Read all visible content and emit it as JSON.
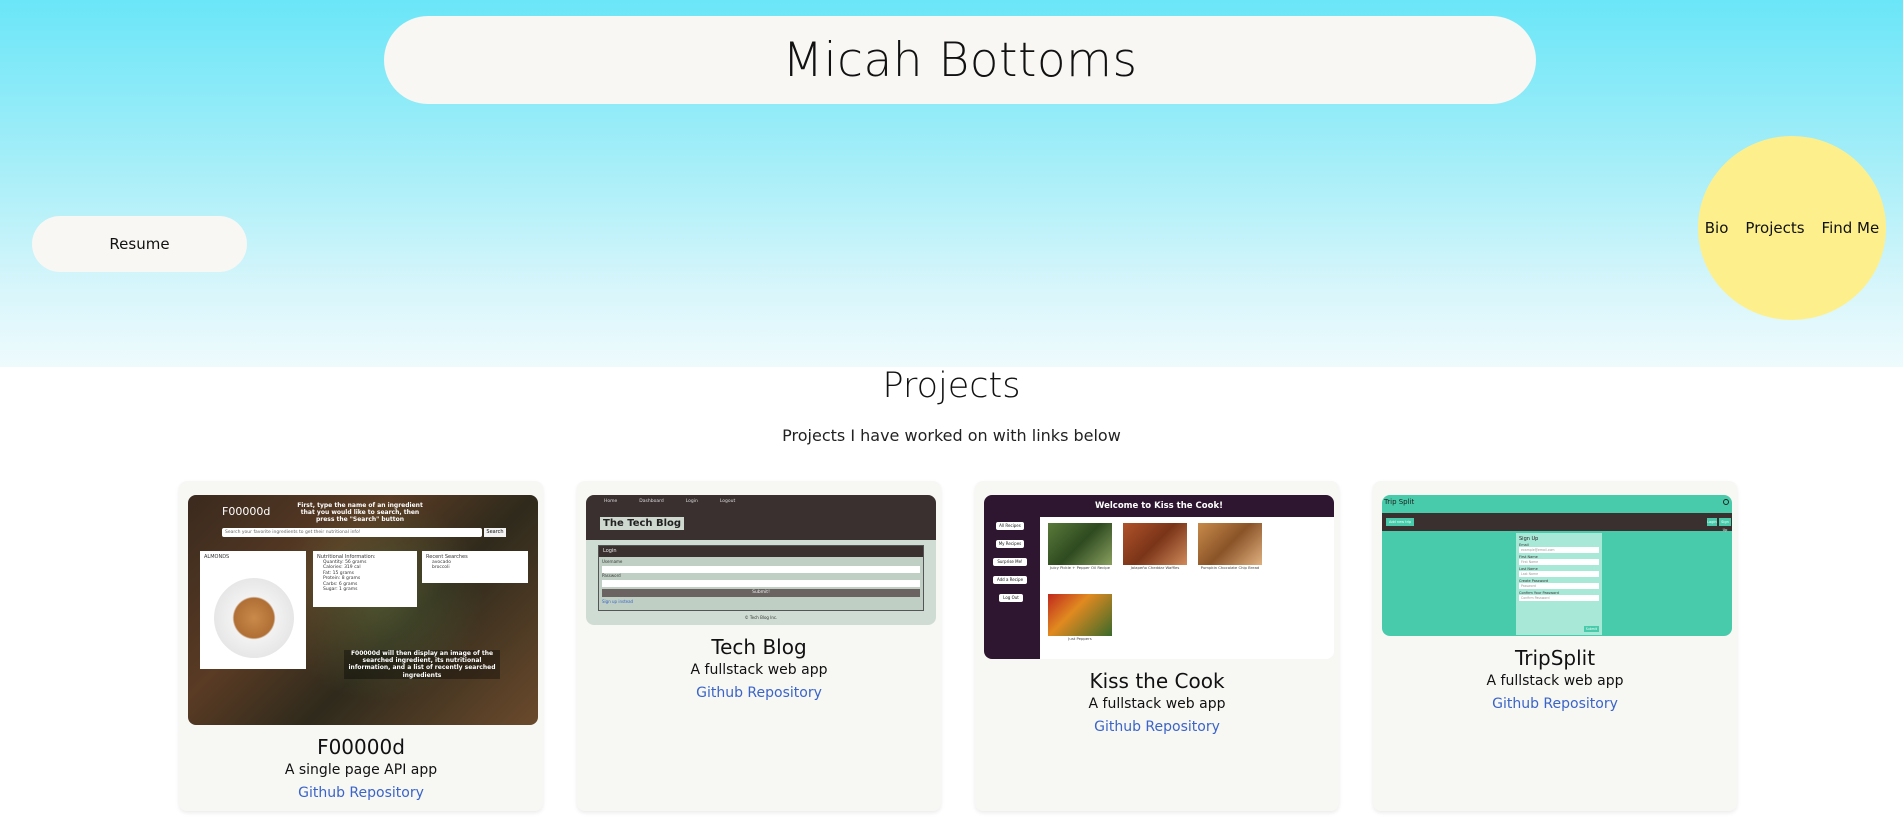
{
  "header": {
    "title": "Micah Bottoms",
    "resume_label": "Resume"
  },
  "nav": {
    "items": [
      "Bio",
      "Projects",
      "Find Me"
    ]
  },
  "projects_section": {
    "title": "Projects",
    "subtitle": "Projects I have worked on with links below",
    "cards": [
      {
        "title": "F00000d",
        "description": "A single page API app",
        "link": "Github Repository",
        "shot": {
          "brand": "F00000d",
          "instruction": "First, type the name of an ingredient that you would like to search, then press the \"Search\" button",
          "search_placeholder": "Search your favorite ingredients to get their nutritional info!",
          "search_btn": "Search",
          "ingredient": "ALMONDS",
          "nutrition_title": "Nutritional Information:",
          "nutrition_items": [
            "Quantity: 56 grams",
            "Calories: 319 cal",
            "Fat: 15 grams",
            "Protein: 8 grams",
            "Carbs: 6 grams",
            "Sugar: 1 grams"
          ],
          "recent_title": "Recent Searches",
          "recent_items": [
            "avocado",
            "broccoli"
          ],
          "caption": "F00000d will then display an image of the searched ingredient, its nutritional information, and a list of recently searched ingredients"
        }
      },
      {
        "title": "Tech Blog",
        "description": "A fullstack web app",
        "link": "Github Repository",
        "shot": {
          "nav": [
            "Home",
            "Dashboard",
            "Login",
            "Logout"
          ],
          "brand": "The Tech Blog",
          "form_title": "Login",
          "field1": "Username",
          "field2": "Password",
          "submit": "Submit!",
          "signup": "Sign up instead",
          "footer": "© Tech Blog Inc."
        }
      },
      {
        "title": "Kiss the Cook",
        "description": "A fullstack web app",
        "link": "Github Repository",
        "shot": {
          "banner": "Welcome to Kiss the Cook!",
          "menu": [
            "All Recipes",
            "My Recipes",
            "Surprise Me!",
            "Add a Recipe",
            "Log Out"
          ],
          "recipes": [
            "Juicy Pickle + Pepper Oil Recipe",
            "Jalapeño Cheddar Waffles",
            "Pumpkin Chocolate Chip Bread",
            "Just Peppers"
          ]
        }
      },
      {
        "title": "TripSplit",
        "description": "A fullstack web app",
        "link": "Github Repository",
        "shot": {
          "brand": "Trip Split",
          "top_button": "Add new trip",
          "right_buttons": [
            "Login",
            "Sign Up"
          ],
          "form_title": "Sign Up",
          "fields": [
            "Email",
            "First Name",
            "Last Name",
            "Create Password",
            "Confirm Your Password"
          ],
          "placeholders": [
            "example@email.com",
            "First Name",
            "Last Name",
            "Password",
            "Confirm Password"
          ],
          "submit": "Submit"
        }
      }
    ]
  },
  "colors": {
    "hero_top": "#6ae6f8",
    "pill": "#f8f7f3",
    "nav_circle": "#fdf08c",
    "link": "#3a64c8"
  }
}
